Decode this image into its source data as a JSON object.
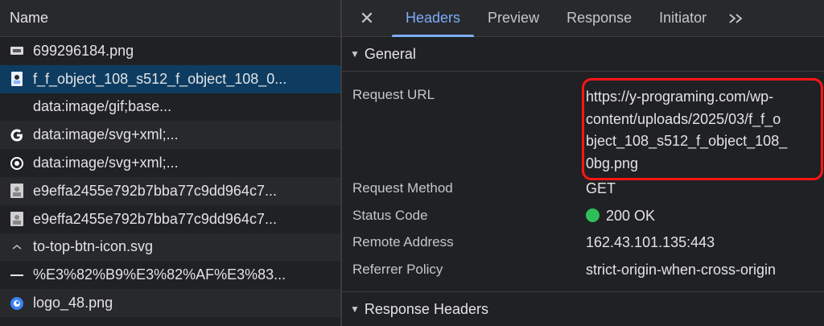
{
  "requests": {
    "header": "Name",
    "items": [
      {
        "icon": "image-icon",
        "name": "699296184.png"
      },
      {
        "icon": "image-icon",
        "name": "f_f_object_108_s512_f_object_108_0..."
      },
      {
        "icon": "blank-icon",
        "name": "data:image/gif;base..."
      },
      {
        "icon": "google-g-icon",
        "name": "data:image/svg+xml;..."
      },
      {
        "icon": "target-icon",
        "name": "data:image/svg+xml;..."
      },
      {
        "icon": "image-icon",
        "name": "e9effa2455e792b7bba77c9dd964c7..."
      },
      {
        "icon": "image-icon",
        "name": "e9effa2455e792b7bba77c9dd964c7..."
      },
      {
        "icon": "chevron-up-icon",
        "name": "to-top-btn-icon.svg"
      },
      {
        "icon": "dash-icon",
        "name": "%E3%82%B9%E3%82%AF%E3%83..."
      },
      {
        "icon": "logo-icon",
        "name": "logo_48.png"
      }
    ]
  },
  "tabs": {
    "close": "✕",
    "items": [
      "Headers",
      "Preview",
      "Response",
      "Initiator"
    ],
    "more": "»"
  },
  "general": {
    "title": "General",
    "request_url_label": "Request URL",
    "request_url_lines": [
      "https://y-programing.com/wp-",
      "content/uploads/2025/03/f_f_o",
      "bject_108_s512_f_object_108_",
      "0bg.png"
    ],
    "request_method_label": "Request Method",
    "request_method": "GET",
    "status_code_label": "Status Code",
    "status_code": "200 OK",
    "remote_address_label": "Remote Address",
    "remote_address": "162.43.101.135:443",
    "referrer_policy_label": "Referrer Policy",
    "referrer_policy": "strict-origin-when-cross-origin"
  },
  "response_headers": {
    "title": "Response Headers"
  },
  "colors": {
    "accent": "#7cacf8",
    "selected_row": "#0e3c61",
    "status_ok": "#2fbf59",
    "highlight_box": "#ff1515"
  }
}
